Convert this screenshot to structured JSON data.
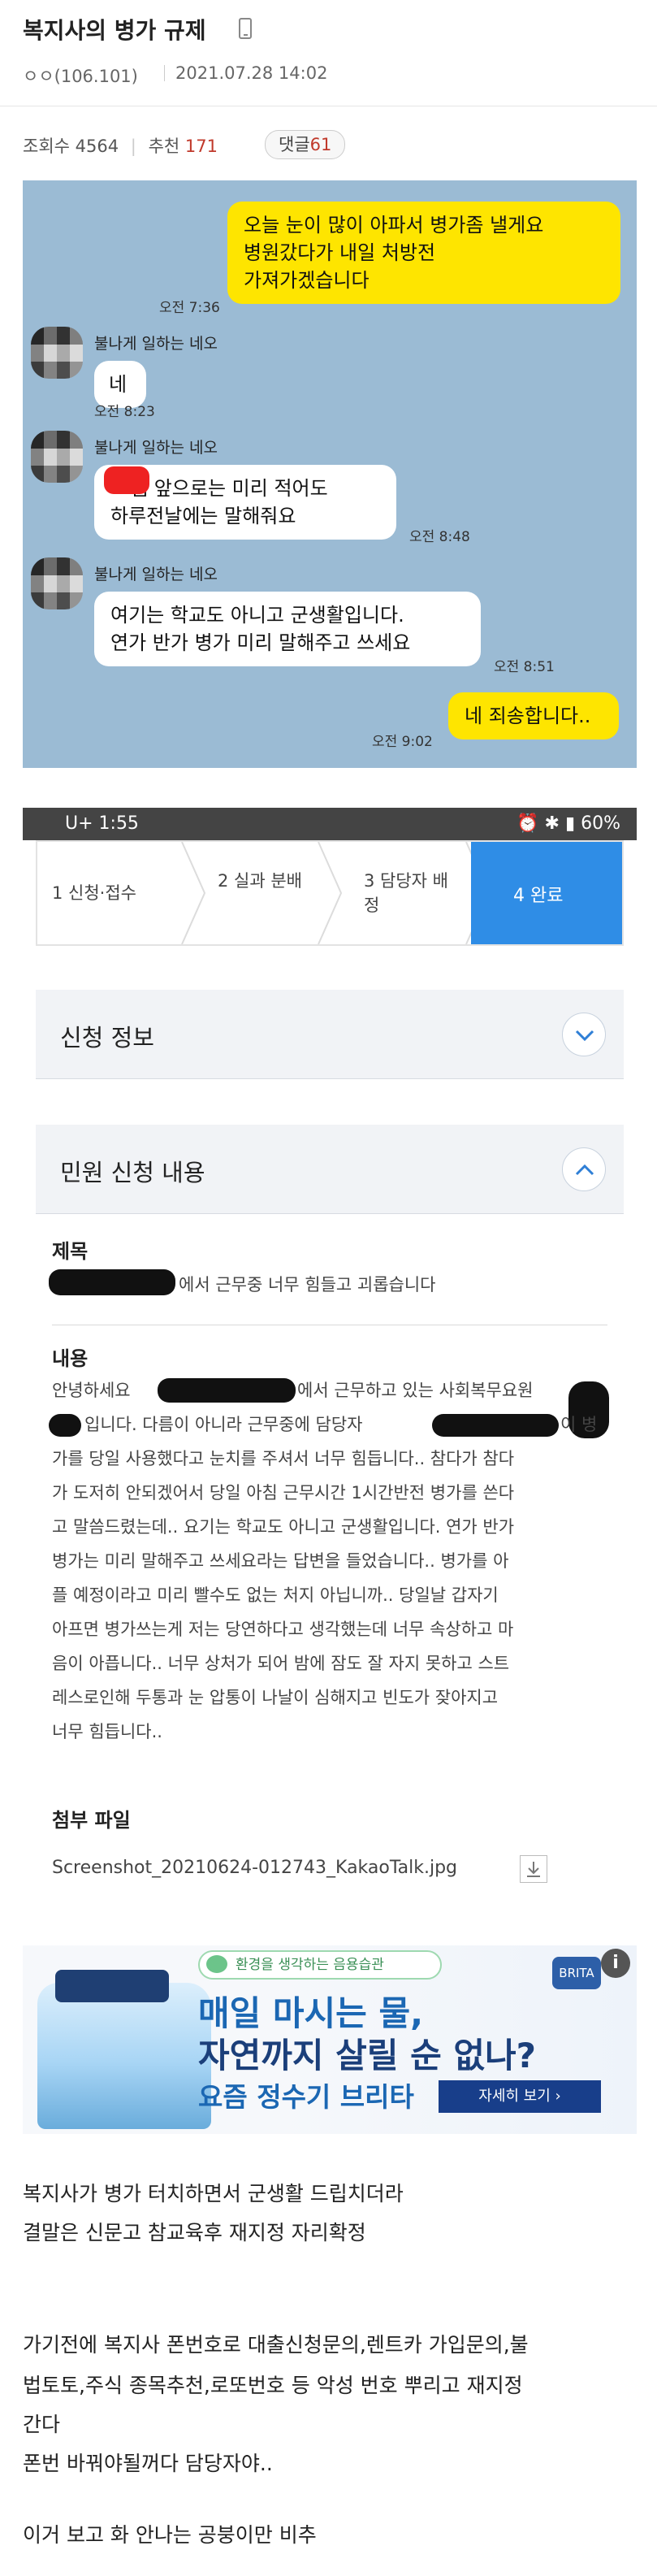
{
  "header": {
    "title": "복지사의 병가 규제",
    "author": "ㅇㅇ(106.101)",
    "date": "2021.07.28 14:02"
  },
  "stats": {
    "views_label": "조회수",
    "views": "4564",
    "recommend_label": "추천",
    "recommend": "171",
    "comments_label": "댓글",
    "comments": "61"
  },
  "chat": {
    "messages": [
      {
        "id": "m1",
        "side": "me",
        "lines": [
          "오늘 눈이 많이 아파서 병가좀 낼게요",
          "병원갔다가 내일 처방전",
          "가져가겠습니다"
        ],
        "time": "오전 7:36"
      },
      {
        "id": "m2",
        "side": "other",
        "sender": "불나게 일하는 네오",
        "lines": [
          "네"
        ],
        "time": "오전 8:23"
      },
      {
        "id": "m3",
        "side": "other",
        "sender": "불나게 일하는 네오",
        "lines": [
          "쌤 앞으로는 미리 적어도",
          "하루전날에는 말해줘요"
        ],
        "time": "오전 8:48"
      },
      {
        "id": "m4",
        "side": "other",
        "sender": "불나게 일하는 네오",
        "lines": [
          "여기는 학교도 아니고 군생활입니다.",
          "연가 반가 병가 미리 말해주고 쓰세요"
        ],
        "time": "오전 8:51"
      },
      {
        "id": "m5",
        "side": "me",
        "lines": [
          "네 죄송합니다.."
        ],
        "time": "오전 9:02"
      }
    ]
  },
  "statusbar": {
    "left": "U+ 1:55",
    "right": "60%"
  },
  "steps": [
    {
      "label": "1 신청·접수"
    },
    {
      "label": "2 실과 분배"
    },
    {
      "label": "3 담당자 배정"
    },
    {
      "label": "4 완료"
    }
  ],
  "sections": {
    "info": "신청 정보",
    "content": "민원 신청 내용"
  },
  "complaint": {
    "title_label": "제목",
    "title_text": "에서 근무중 너무 힘들고 괴롭습니다",
    "content_label": "내용",
    "content_lines": [
      "안녕하세요",
      "에서 근무하고 있는 사회복무요원",
      "입니다. 다름이 아니라 근무중에 담당자",
      "이 병",
      "가를 당일 사용했다고 눈치를 주셔서 너무 힘듭니다.. 참다가 참다",
      "가 도저히 안되겠어서 당일 아침 근무시간 1시간반전 병가를 쓴다",
      "고 말씀드렸는데.. 요기는 학교도 아니고 군생활입니다. 연가 반가",
      "병가는 미리 말해주고 쓰세요라는 답변을 들었습니다.. 병가를 아",
      "플 예정이라고 미리 빨수도 없는 처지 아닙니까.. 당일날 갑자기",
      "아프면 병가쓰는게 저는 당연하다고 생각했는데 너무 속상하고 마",
      "음이 아픕니다.. 너무 상처가 되어 밤에 잠도 잘 자지 못하고 스트",
      "레스로인해 두통과 눈 압통이 나날이 심해지고 빈도가 잦아지고",
      "너무 힘듭니다.."
    ],
    "attach_label": "첨부 파일",
    "attach_file": "Screenshot_20210624-012743_KakaoTalk.jpg"
  },
  "ad": {
    "badge": "환경을 생각하는 음용습관",
    "line1": "매일 마시는 물,",
    "line2": "자연까지 살릴 순 없나?",
    "line3": "요즘 정수기 브리타",
    "cta": "자세히 보기  ›",
    "logo": "BRITA",
    "info_icon": "info-icon"
  },
  "post_body": [
    "복지사가 병가 터치하면서 군생활 드립치더라",
    "결말은 신문고 참교육후 재지정 자리확정",
    "가기전에 복지사 폰번호로 대출신청문의,렌트카 가입문의,불",
    "법토토,주식 종목추천,로또번호 등 악성 번호 뿌리고 재지정",
    "간다",
    "폰번 바꿔야될꺼다 담당자야..",
    "이거 보고 화 안나는 공붕이만 비추"
  ]
}
